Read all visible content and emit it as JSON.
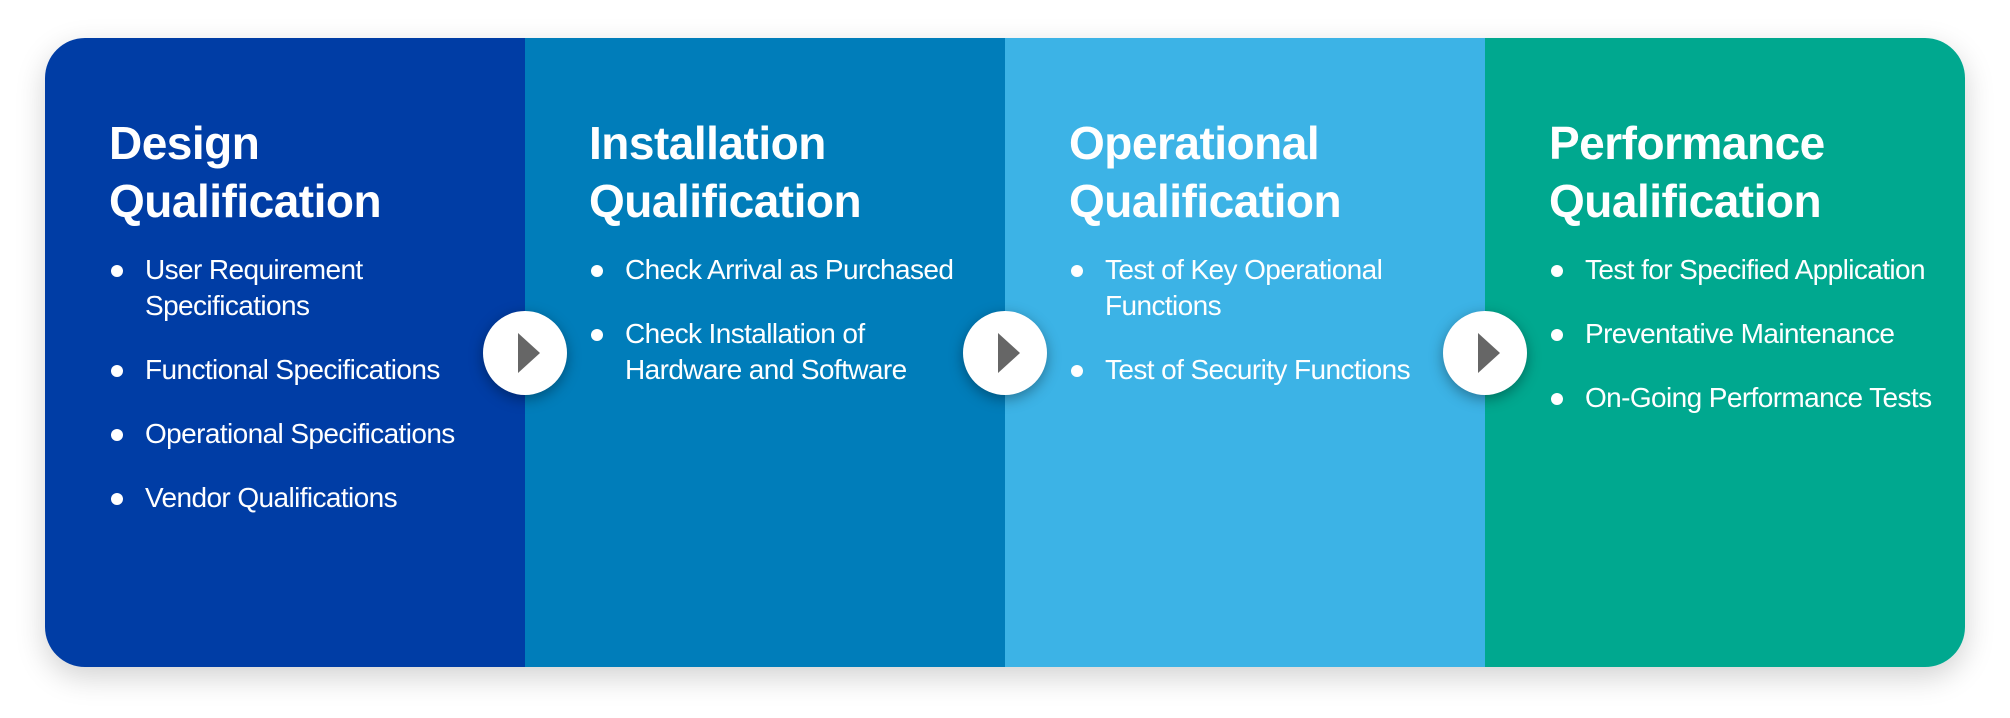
{
  "colors": {
    "design": "#003DA5",
    "installation": "#007DBA",
    "operational": "#3CB3E6",
    "performance": "#00A88F",
    "arrow": "#666666"
  },
  "arrow_icon": "play-triangle-icon",
  "stages": [
    {
      "title_line1": "Design",
      "title_line2": "Qualification",
      "items": [
        "User Requirement Specifications",
        "Functional Specifications",
        "Operational Specifications",
        "Vendor Qualifications"
      ]
    },
    {
      "title_line1": "Installation",
      "title_line2": "Qualification",
      "items": [
        "Check Arrival as Purchased",
        "Check Installation of Hardware and Software"
      ]
    },
    {
      "title_line1": "Operational",
      "title_line2": "Qualification",
      "items": [
        "Test of Key Operational Functions",
        "Test of Security Functions"
      ]
    },
    {
      "title_line1": "Performance",
      "title_line2": "Qualification",
      "items": [
        "Test for Specified Application",
        "Preventative Maintenance",
        "On-Going Performance Tests"
      ]
    }
  ]
}
